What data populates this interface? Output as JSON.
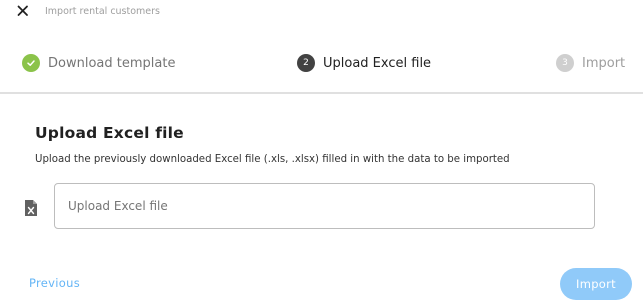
{
  "header": {
    "close_icon": "close-icon",
    "title": "Import rental customers"
  },
  "stepper": {
    "steps": [
      {
        "number": "1",
        "label": "Download template",
        "status": "completed",
        "icon": "check-icon",
        "color": "#8bc34a"
      },
      {
        "number": "2",
        "label": "Upload Excel file",
        "status": "active",
        "color": "#424242"
      },
      {
        "number": "3",
        "label": "Import",
        "status": "inactive",
        "color": "#cfcfcf"
      }
    ]
  },
  "main": {
    "title": "Upload Excel file",
    "description": "Upload the previously downloaded Excel file (.xls, .xlsx) filled in with the data to be imported",
    "file_icon": "excel-file-icon",
    "upload_field": {
      "placeholder": "Upload Excel file",
      "value": ""
    }
  },
  "footer": {
    "previous_label": "Previous",
    "import_label": "Import"
  },
  "colors": {
    "accent": "#64b5f6",
    "import_button_disabled": "#90caf9",
    "step_completed": "#8bc34a",
    "step_active": "#424242"
  }
}
